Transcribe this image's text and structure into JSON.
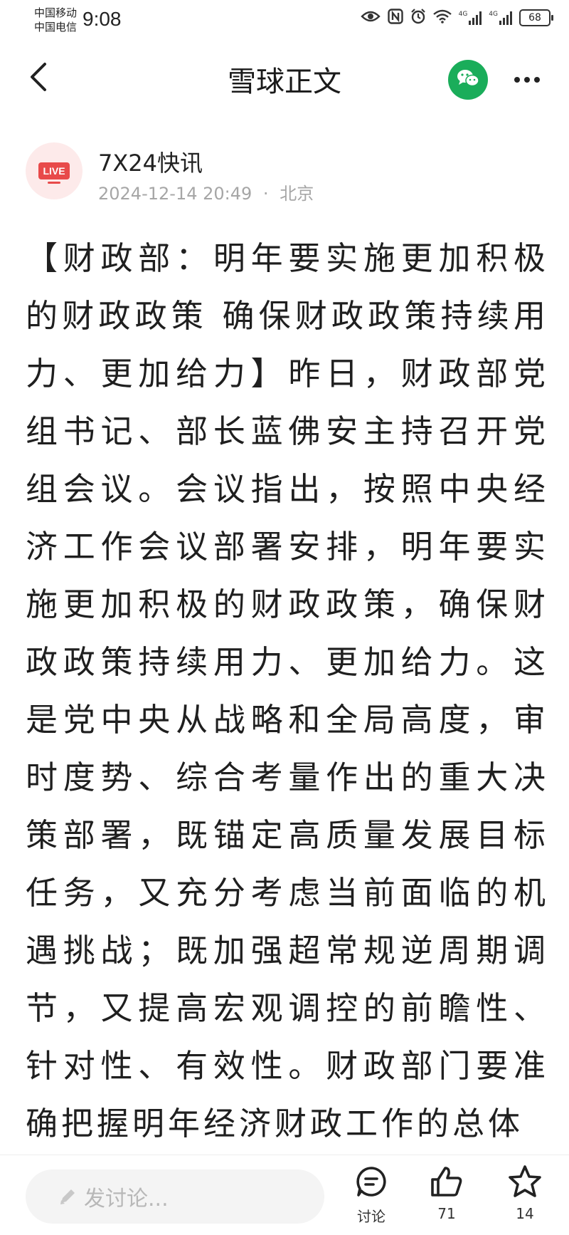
{
  "status": {
    "carrier1": "中国移动",
    "carrier2": "中国电信",
    "time": "9:08",
    "battery": "68",
    "network1": "4G",
    "network2": "4G"
  },
  "nav": {
    "title": "雪球正文",
    "icons": [
      "back-icon",
      "wechat-icon",
      "more-icon"
    ]
  },
  "author": {
    "avatar_badge": "LIVE",
    "name": "7X24快讯",
    "datetime": "2024-12-14 20:49",
    "separator": "·",
    "location": "北京"
  },
  "article": {
    "body": "【财政部：明年要实施更加积极的财政政策 确保财政政策持续用力、更加给力】昨日，财政部党组书记、部长蓝佛安主持召开党组会议。会议指出，按照中央经济工作会议部署安排，明年要实施更加积极的财政政策，确保财政政策持续用力、更加给力。这是党中央从战略和全局高度，审时度势、综合考量作出的重大决策部署，既锚定高质量发展目标任务，又充分考虑当前面临的机遇挑战；既加强超常规逆周期调节，又提高宏观调控的前瞻性、针对性、有效性。财政部门要准确把握明年经济财政工作的总体"
  },
  "bottom": {
    "comment_placeholder": "发讨论...",
    "discuss_label": "讨论",
    "like_count": "71",
    "favorite_count": "14"
  },
  "colors": {
    "wechat_green": "#1aad5a",
    "live_red": "#e84a4a",
    "meta_gray": "#a6a6a6"
  }
}
